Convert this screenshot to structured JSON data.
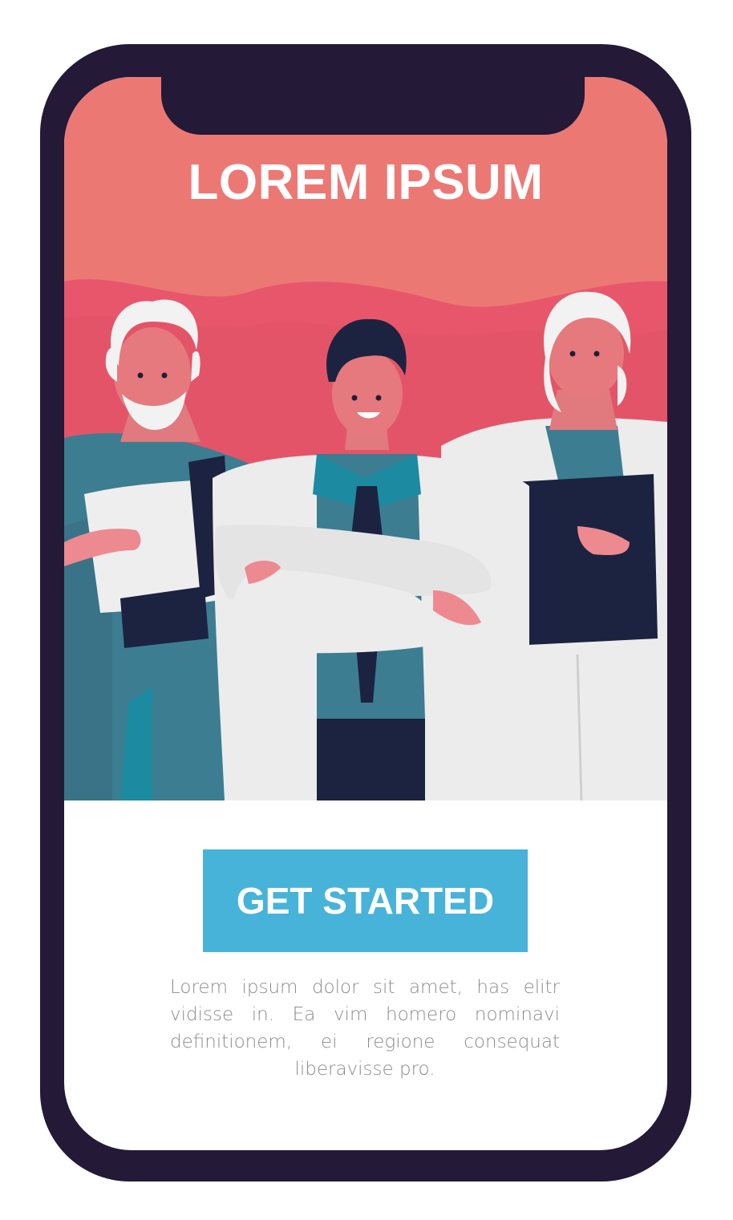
{
  "hero": {
    "title": "LOREM IPSUM"
  },
  "cta": {
    "label": "GET STARTED"
  },
  "description": {
    "text": "Lorem ipsum dolor sit amet, has elitr vidisse in. Ea vim homero nominavi definitionem, ei regione consequat liberavisse pro."
  },
  "colors": {
    "frame": "#241936",
    "hero_background": "#ec7874",
    "hero_wave": "#e8566c",
    "button": "#47b3d9",
    "body_text": "#8c8c8c"
  },
  "illustration": {
    "subject": "three-doctors-illustration"
  }
}
